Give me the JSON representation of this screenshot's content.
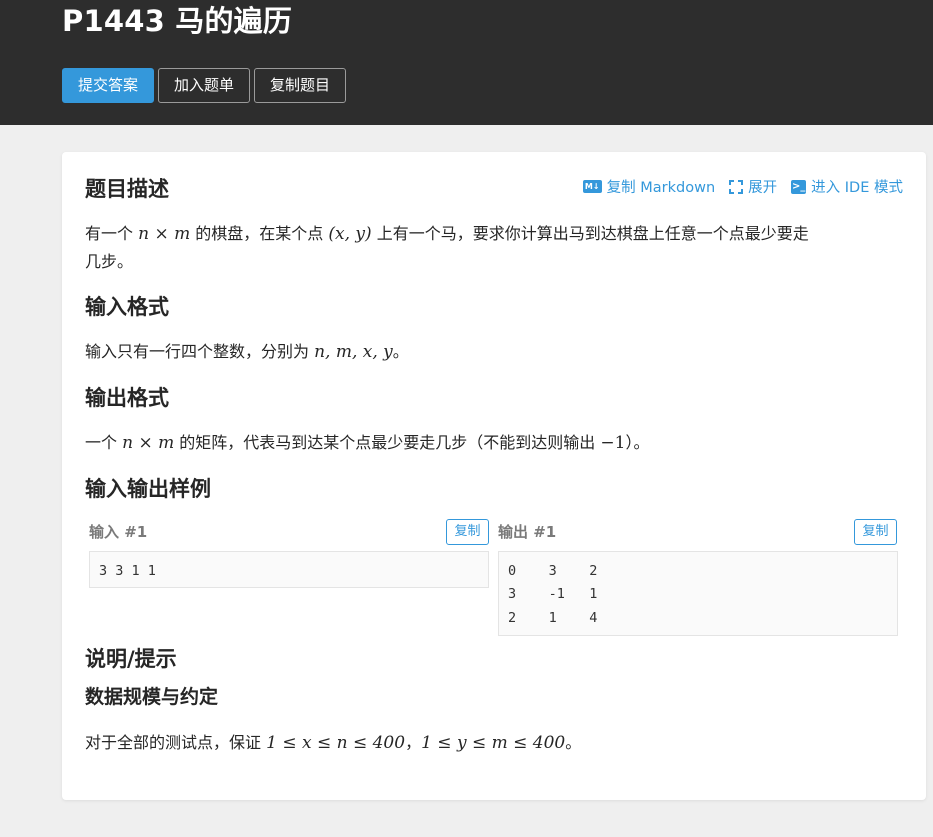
{
  "header": {
    "title": "P1443 马的遍历",
    "buttons": {
      "submit": "提交答案",
      "add_to_list": "加入题单",
      "copy_problem": "复制题目"
    }
  },
  "toolbar": {
    "copy_markdown_icon": "M↓",
    "copy_markdown": "复制 Markdown",
    "expand": "展开",
    "ide_icon": ">_",
    "ide_mode": "进入 IDE 模式"
  },
  "sections": {
    "description": {
      "heading": "题目描述",
      "text_1": "有一个 ",
      "math_1": "n × m",
      "text_2": " 的棋盘，在某个点 ",
      "math_2": "(x, y)",
      "text_3": " 上有一个马，要求你计算出马到达棋盘上任意一个点最少要走",
      "text_4": "几步。"
    },
    "input_format": {
      "heading": "输入格式",
      "text_1": "输入只有一行四个整数，分别为 ",
      "math_1": "n, m, x, y",
      "text_2": "。"
    },
    "output_format": {
      "heading": "输出格式",
      "text_1": "一个 ",
      "math_1": "n × m",
      "text_2": " 的矩阵，代表马到达某个点最少要走几步（不能到达则输出 ",
      "math_2": "−1",
      "text_3": "）。"
    },
    "samples": {
      "heading": "输入输出样例",
      "input_label": "输入 #1",
      "output_label": "输出 #1",
      "copy_label": "复制",
      "input_content": "3 3 1 1",
      "output_content": "0    3    2\n3    -1   1\n2    1    4"
    },
    "hint": {
      "heading": "说明/提示",
      "subheading": "数据规模与约定",
      "text_1": "对于全部的测试点，保证 ",
      "math_1": "1 ≤ x ≤ n ≤ 400",
      "text_2": "，",
      "math_2": "1 ≤ y ≤ m ≤ 400",
      "text_3": "。"
    }
  },
  "colors": {
    "header_bg": "#2d2d2d",
    "primary": "#3498db",
    "page_bg": "#efefef"
  }
}
